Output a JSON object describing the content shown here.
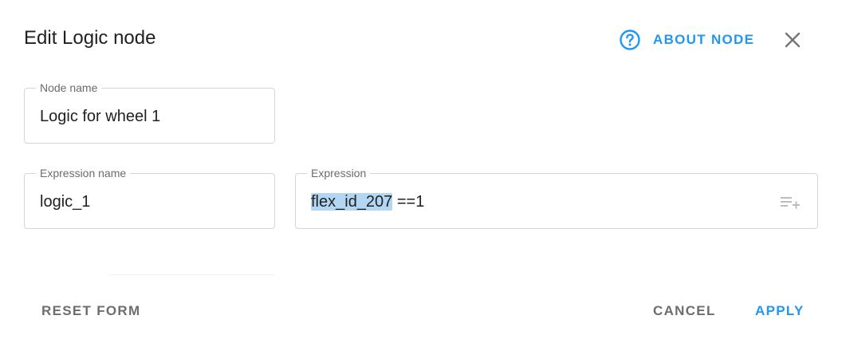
{
  "dialog": {
    "title": "Edit Logic node",
    "about_label": "ABOUT NODE",
    "help_icon": "help-circle-icon",
    "close_icon": "close-icon"
  },
  "fields": {
    "node_name": {
      "label": "Node name",
      "value": "Logic for wheel 1"
    },
    "expression_name": {
      "label": "Expression name",
      "value": "logic_1"
    },
    "expression": {
      "label": "Expression",
      "value_selected": "flex_id_207",
      "value_rest": " ==1",
      "action_icon": "playlist-add-icon"
    }
  },
  "actions": {
    "reset": "RESET FORM",
    "cancel": "CANCEL",
    "apply": "APPLY"
  },
  "colors": {
    "accent": "#2196f3",
    "selection": "#b3d7f2",
    "muted_button": "#6d6d6d"
  }
}
